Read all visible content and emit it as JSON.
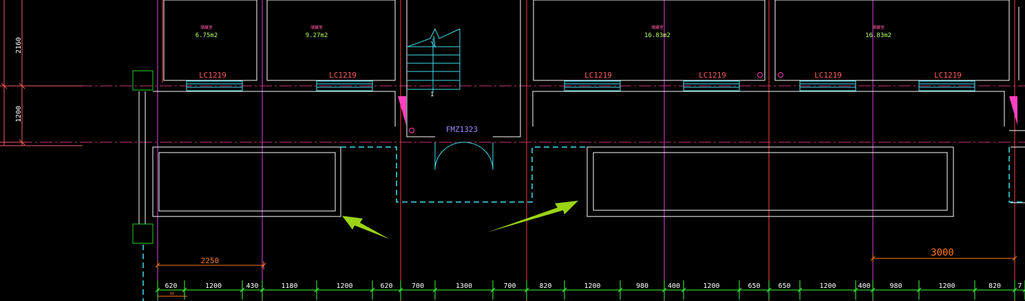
{
  "colors": {
    "background": "#000000",
    "wall": "#ffffff",
    "axis_red": "#ff3b3b",
    "axis_magenta": "#e040e0",
    "axis_dashed": "#d03080",
    "window": "#40e0f0",
    "door": "#40e0f0",
    "room_label": "#ff5aa0",
    "area_label": "#b8ff6a",
    "dimension_green": "#40ff40",
    "dimension_orange": "#ff7a1a",
    "arrow": "#9ad412",
    "column": "#2ad12a"
  },
  "rooms": [
    {
      "name": "储藏室",
      "area": "6.75m2"
    },
    {
      "name": "储藏室",
      "area": "9.27m2"
    },
    {
      "name": "储藏室",
      "area": "16.83m2"
    },
    {
      "name": "储藏室",
      "area": "16.83m2"
    }
  ],
  "windows": [
    "LC1219",
    "LC1219",
    "LC1219",
    "LC1219",
    "LC1219",
    "LC1219"
  ],
  "door": {
    "label": "FMZ1323"
  },
  "stair": {
    "label": "1"
  },
  "left_dims": [
    "2160",
    "1200"
  ],
  "orange_dims": {
    "left": "2250",
    "right": "3000",
    "small": "60"
  },
  "bottom_dims": [
    "620",
    "1200",
    "430",
    "1180",
    "1200",
    "620",
    "700",
    "1300",
    "700",
    "820",
    "1200",
    "980",
    "400",
    "1200",
    "650",
    "650",
    "1200",
    "400",
    "980",
    "1200",
    "820",
    "7"
  ]
}
